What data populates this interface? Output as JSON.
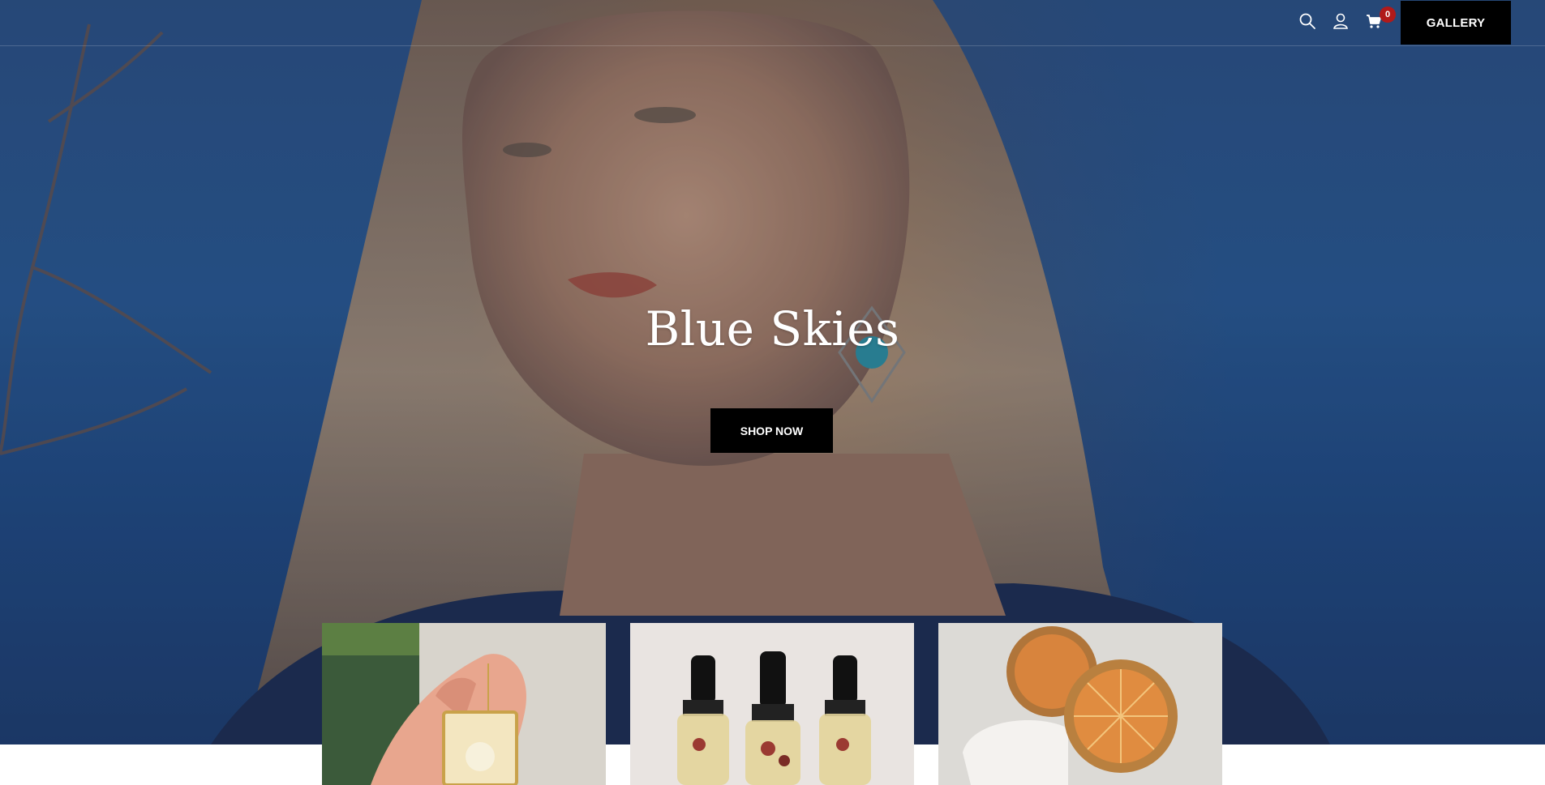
{
  "header": {
    "icons": [
      "search-icon",
      "user-icon",
      "cart-icon"
    ],
    "cart_count": "0",
    "gallery_label": "GALLERY"
  },
  "hero": {
    "title": "Blue Skies",
    "cta_label": "SHOP NOW"
  },
  "tiles": [
    {
      "name": "resin-pendant-earring"
    },
    {
      "name": "dropper-oil-bottles"
    },
    {
      "name": "dried-orange-slices"
    }
  ],
  "colors": {
    "sky": "#2a5a96",
    "button_bg": "#000000",
    "button_text": "#ffffff",
    "badge": "#b01a1a"
  }
}
